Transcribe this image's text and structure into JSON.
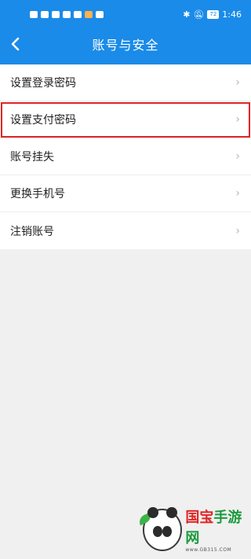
{
  "status_bar": {
    "time": "1:46",
    "battery": "72"
  },
  "header": {
    "title": "账号与安全",
    "back_icon": "chevron-left-icon"
  },
  "menu": {
    "items": [
      {
        "label": "设置登录密码"
      },
      {
        "label": "设置支付密码",
        "highlighted": true
      },
      {
        "label": "账号挂失"
      },
      {
        "label": "更换手机号"
      },
      {
        "label": "注销账号"
      }
    ],
    "chevron": "›"
  },
  "watermark": {
    "brand_part1": "国宝",
    "brand_part2": "手游网",
    "url": "www.GB315.COM"
  },
  "colors": {
    "header_bg": "#1a8be8",
    "page_bg": "#f0f0f0",
    "highlight": "#e02424"
  }
}
